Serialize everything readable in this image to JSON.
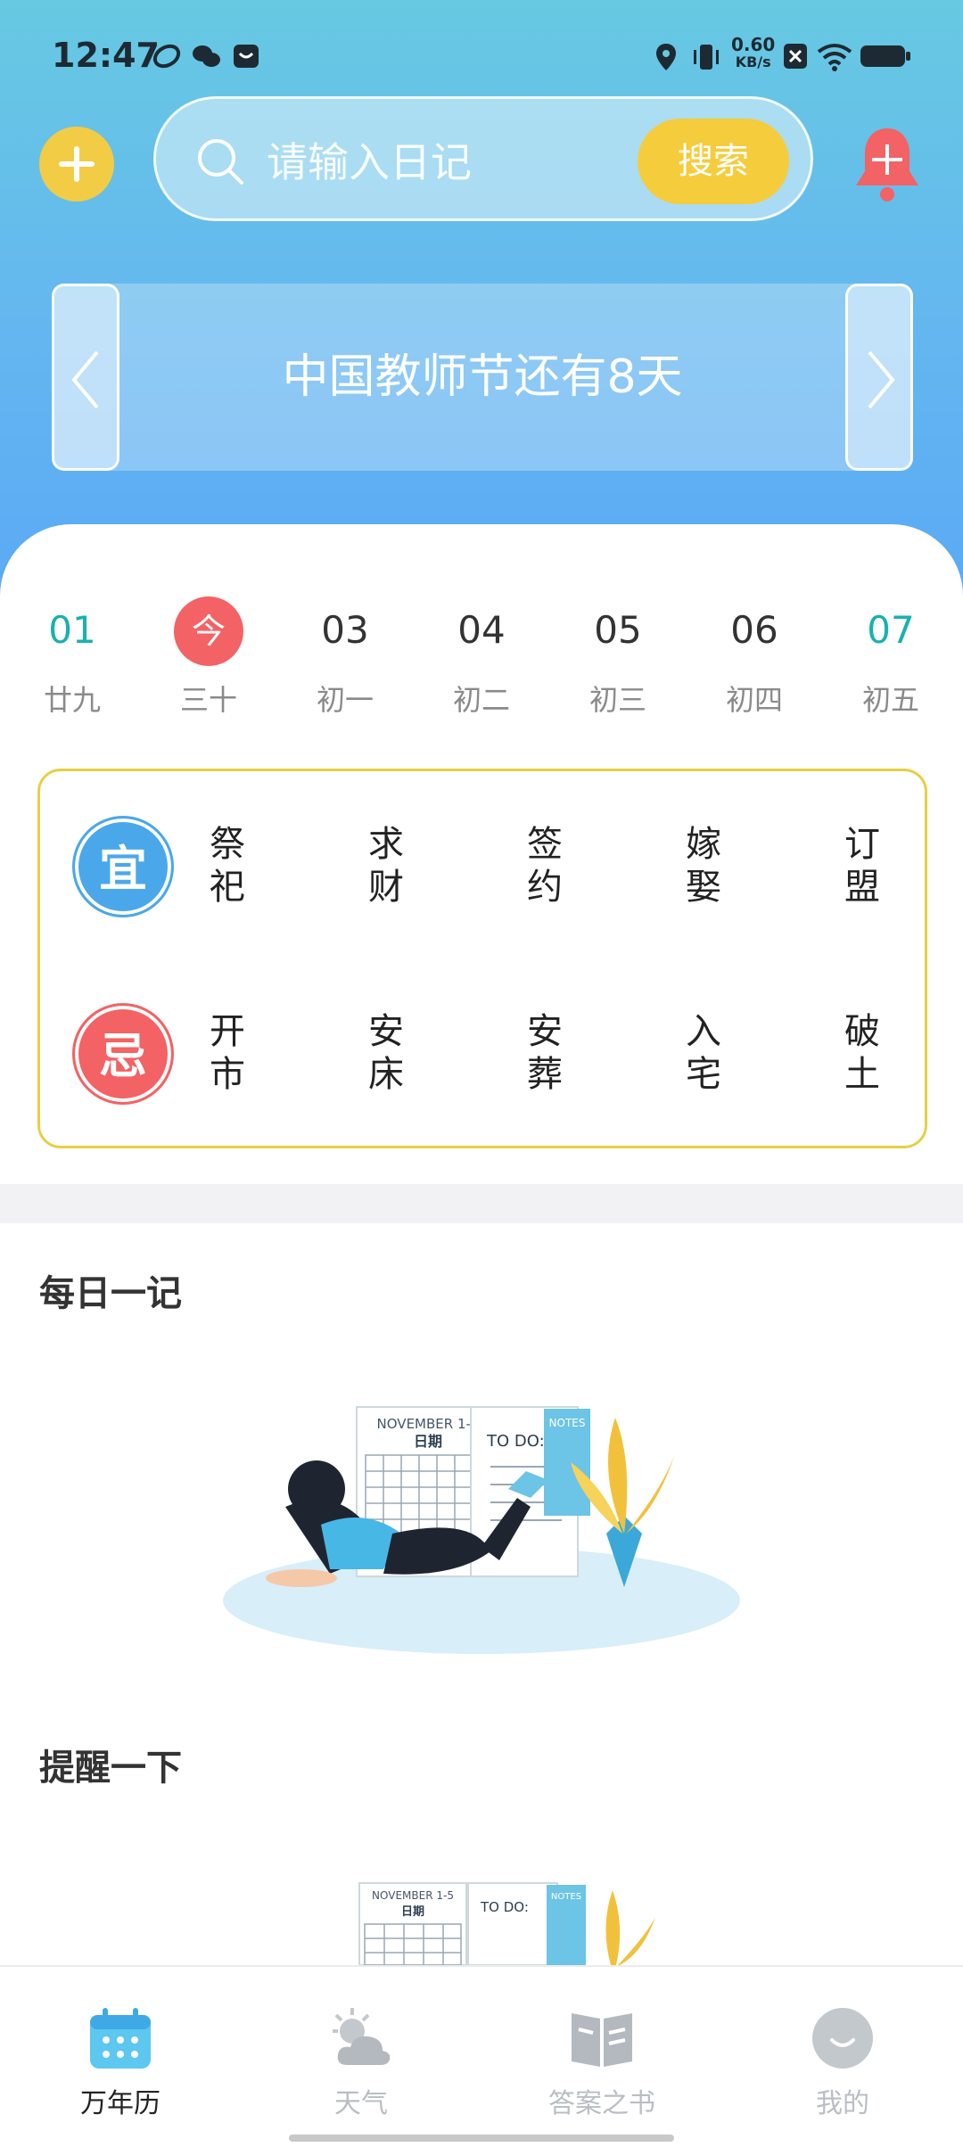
{
  "status_bar": {
    "time": "12:47",
    "speed_value": "0.60",
    "speed_unit": "KB/s"
  },
  "search": {
    "placeholder": "请输入日记",
    "button_label": "搜索"
  },
  "banner": {
    "text": "中国教师节还有8天"
  },
  "week": [
    {
      "num": "01",
      "lunar": "廿九"
    },
    {
      "num": "今",
      "lunar": "三十"
    },
    {
      "num": "03",
      "lunar": "初一"
    },
    {
      "num": "04",
      "lunar": "初二"
    },
    {
      "num": "05",
      "lunar": "初三"
    },
    {
      "num": "06",
      "lunar": "初四"
    },
    {
      "num": "07",
      "lunar": "初五"
    }
  ],
  "almanac": {
    "yi_label": "宜",
    "ji_label": "忌",
    "yi_items": [
      "祭祀",
      "求财",
      "签约",
      "嫁娶",
      "订盟"
    ],
    "ji_items": [
      "开市",
      "安床",
      "安葬",
      "入宅",
      "破土"
    ]
  },
  "sections": {
    "diary_title": "每日一记",
    "reminder_title": "提醒一下"
  },
  "illustration": {
    "header": "NOVEMBER 1-5",
    "subheader": "日期",
    "todo": "TO DO:",
    "notes": "NOTES"
  },
  "bottom_nav": {
    "items": [
      "万年历",
      "天气",
      "答案之书",
      "我的"
    ],
    "active": "万年历"
  },
  "colors": {
    "accent_yellow": "#f3cc45",
    "today_red": "#f36265",
    "yi_blue": "#4aa8ea",
    "teal": "#19b1b1"
  }
}
